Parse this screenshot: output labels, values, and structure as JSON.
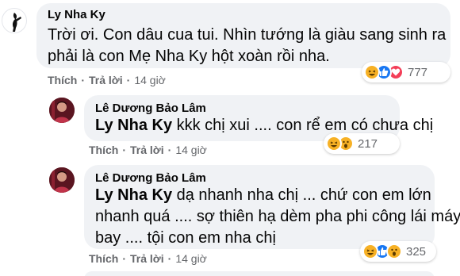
{
  "comments": [
    {
      "author": "Ly Nha Ky",
      "text_line1": "Trời ơi. Con dâu cua tui. Nhìn tướng là giàu sang sinh ra",
      "text_line2": "phải là con Mẹ Nha Ky hột xoàn rồi nha.",
      "like_label": "Thích",
      "reply_label": "Trả lời",
      "time": "14 giờ",
      "reaction_count": "777",
      "reactions": [
        "haha-icon",
        "like-icon",
        "love-icon"
      ]
    },
    {
      "author": "Lê Dương Bảo Lâm",
      "mention": "Ly Nha Ky",
      "text_line1": "kkk chị xui .... con rể em có chưa chị",
      "like_label": "Thích",
      "reply_label": "Trả lời",
      "time": "14 giờ",
      "reaction_count": "217",
      "reactions": [
        "haha-icon",
        "wow-icon"
      ]
    },
    {
      "author": "Lê Dương Bảo Lâm",
      "mention": "Ly Nha Ky",
      "text_line1": "dạ nhanh nha chị ... chứ con em lớn",
      "text_line2": "nhanh quá .... sợ thiên hạ dèm pha phi công lái máy",
      "text_line3": "bay .... tội con em nha chị",
      "like_label": "Thích",
      "reply_label": "Trả lời",
      "time": "14 giờ",
      "reaction_count": "325",
      "reactions": [
        "haha-icon",
        "like-icon",
        "wow-icon"
      ]
    }
  ],
  "colors": {
    "bubble": "#f0f2f5",
    "meta_text": "#65676b",
    "like_blue": "#1877f2",
    "haha_yellow": "#f7b125",
    "love_red": "#f33e58"
  }
}
